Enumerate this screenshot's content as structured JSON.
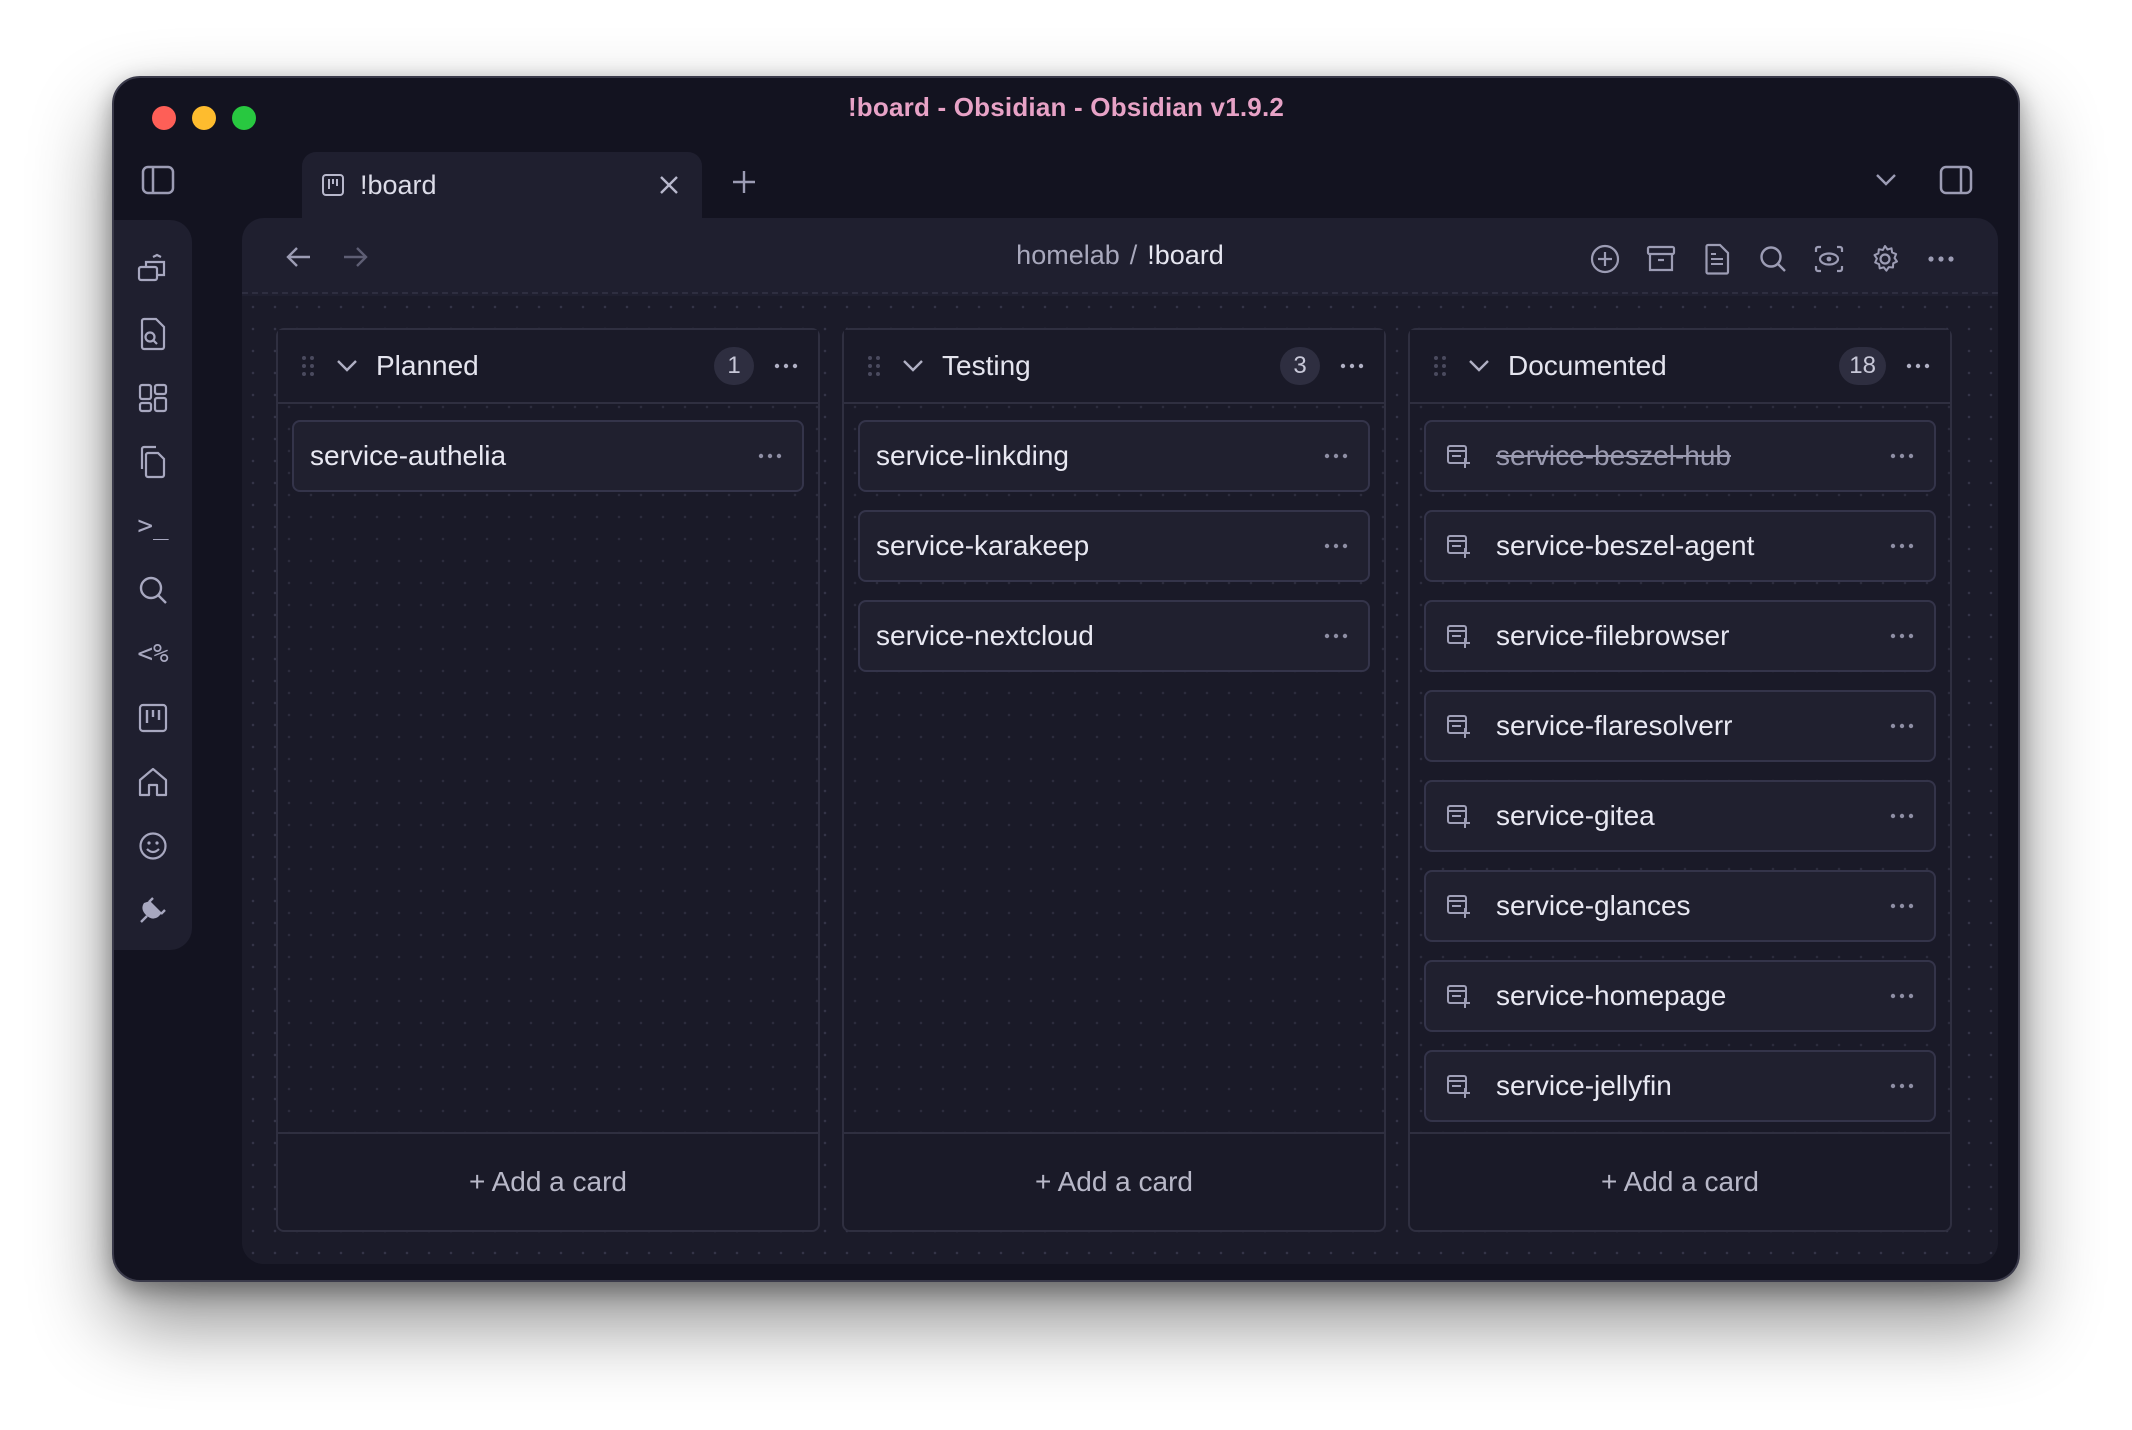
{
  "window": {
    "title": "!board - Obsidian - Obsidian v1.9.2"
  },
  "tab": {
    "label": "!board",
    "icon": "kanban-icon"
  },
  "breadcrumb": {
    "folder": "homelab",
    "separator": "/",
    "current": "!board"
  },
  "ribbon": {
    "items": [
      "publish-icon",
      "file-search-icon",
      "dashboard-icon",
      "copy-files-icon",
      "terminal-icon",
      "search-icon",
      "templater-icon",
      "kanban-icon",
      "home-icon",
      "smiley-icon",
      "plugin-icon"
    ],
    "templater_text": "<%",
    "terminal_text": ">_"
  },
  "actions": [
    "add-card-icon",
    "archive-icon",
    "markdown-icon",
    "search-icon",
    "view-icon",
    "settings-icon",
    "more-icon"
  ],
  "lanes": [
    {
      "title": "Planned",
      "count": "1",
      "cards": [
        {
          "title": "service-authelia",
          "linked": false,
          "done": false
        }
      ],
      "add_label": "+ Add a card"
    },
    {
      "title": "Testing",
      "count": "3",
      "cards": [
        {
          "title": "service-linkding",
          "linked": false,
          "done": false
        },
        {
          "title": "service-karakeep",
          "linked": false,
          "done": false
        },
        {
          "title": "service-nextcloud",
          "linked": false,
          "done": false
        }
      ],
      "add_label": "+ Add a card"
    },
    {
      "title": "Documented",
      "count": "18",
      "cards": [
        {
          "title": "service-beszel-hub",
          "linked": true,
          "done": true
        },
        {
          "title": "service-beszel-agent",
          "linked": true,
          "done": false
        },
        {
          "title": "service-filebrowser",
          "linked": true,
          "done": false
        },
        {
          "title": "service-flaresolverr",
          "linked": true,
          "done": false
        },
        {
          "title": "service-gitea",
          "linked": true,
          "done": false
        },
        {
          "title": "service-glances",
          "linked": true,
          "done": false
        },
        {
          "title": "service-homepage",
          "linked": true,
          "done": false
        },
        {
          "title": "service-jellyfin",
          "linked": true,
          "done": false
        }
      ],
      "add_label": "+ Add a card"
    }
  ],
  "colors": {
    "title": "#e7a2c6",
    "background": "#131320",
    "pane": "#1f1f2f",
    "card": "#20202f",
    "text": "#e8e8f2"
  }
}
